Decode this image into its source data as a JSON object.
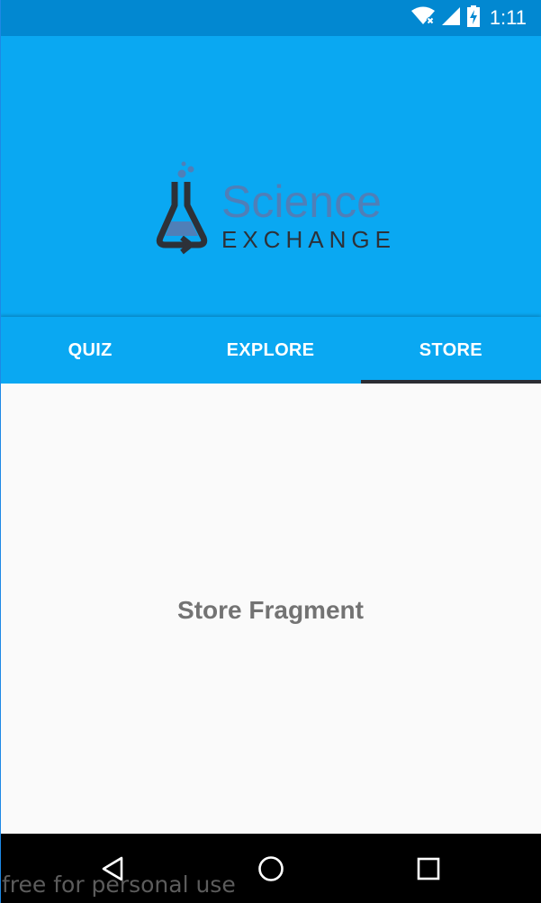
{
  "status_bar": {
    "time": "1:11",
    "icons": [
      "wifi-icon",
      "cellular-signal-icon",
      "battery-charging-icon"
    ]
  },
  "header": {
    "logo": {
      "line1": "Science",
      "line2": "EXCHANGE"
    }
  },
  "tabs": [
    {
      "label": "QUIZ",
      "active": false
    },
    {
      "label": "EXPLORE",
      "active": false
    },
    {
      "label": "STORE",
      "active": true
    }
  ],
  "content": {
    "label": "Store Fragment"
  },
  "nav_bar": {
    "buttons": [
      "back-icon",
      "home-icon",
      "recents-icon"
    ]
  },
  "watermark": "free for personal use",
  "colors": {
    "status_bar": "#0288d1",
    "primary": "#0aa8f2",
    "tab_indicator": "#2b2d33",
    "content_bg": "#fafafa",
    "content_text": "#737373"
  }
}
